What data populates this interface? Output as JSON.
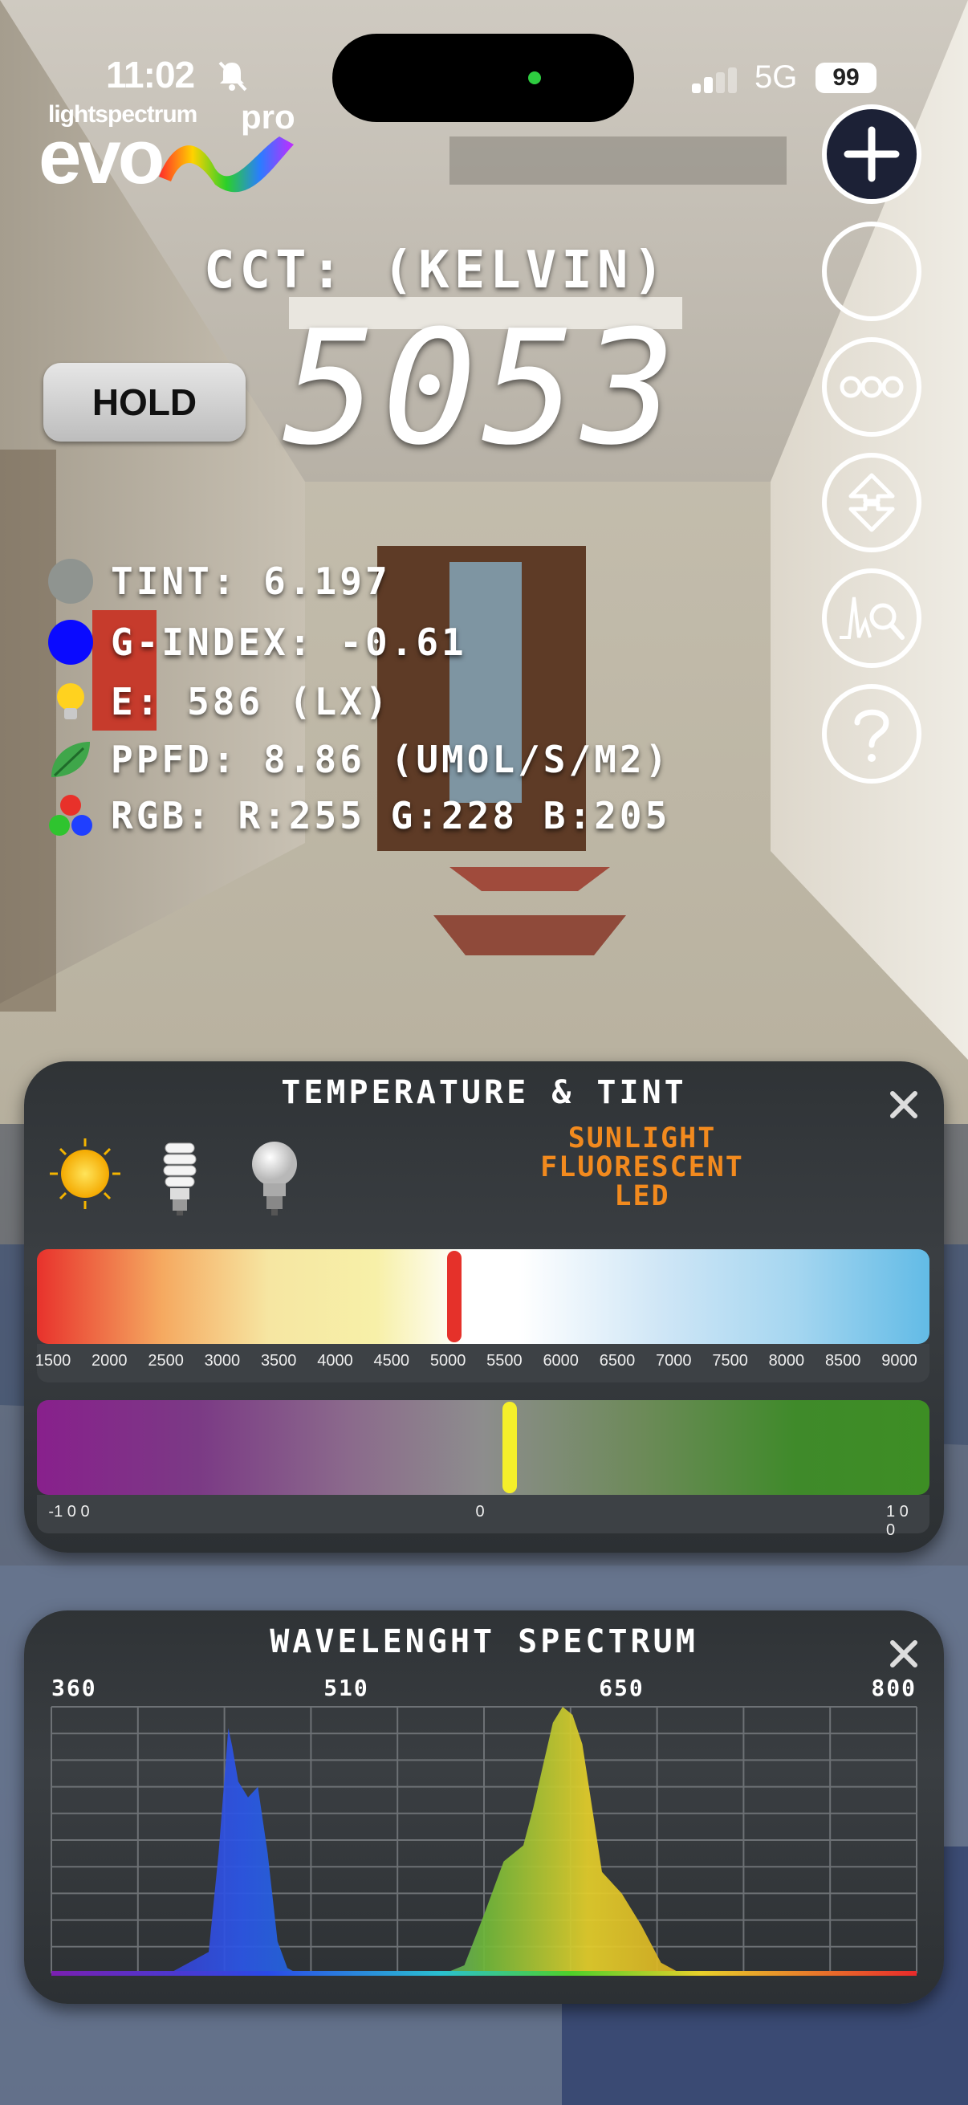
{
  "status_bar": {
    "time": "11:02",
    "network": "5G",
    "battery": "99"
  },
  "logo": {
    "top_text": "lightspectrum",
    "name": "evo",
    "suffix": "pro"
  },
  "cct": {
    "label": "CCT: (KELVIN)",
    "value": "5053"
  },
  "hold_label": "HOLD",
  "metrics": [
    {
      "icon": "gray-circle-icon",
      "text": "TINT: 6.197"
    },
    {
      "icon": "blue-circle-icon",
      "text": "G-INDEX: -0.61"
    },
    {
      "icon": "lightbulb-icon",
      "text": "E: 586 (LX)"
    },
    {
      "icon": "leaf-icon",
      "text": "PPFD: 8.86 (UMOL/S/M2)"
    },
    {
      "icon": "rgb-dots-icon",
      "text": "RGB: R:255 G:228 B:205"
    }
  ],
  "controls": [
    "plus-icon",
    "circle-icon",
    "more-icon",
    "rotate-icon",
    "spectrum-search-icon",
    "help-icon"
  ],
  "temp_panel": {
    "title": "TEMPERATURE & TINT",
    "source_icons": [
      "sun-icon",
      "cfl-bulb-icon",
      "led-bulb-icon"
    ],
    "light_types": [
      "SUNLIGHT",
      "FLUORESCENT",
      "LED"
    ],
    "kelvin_scale": [
      "1500",
      "2000",
      "2500",
      "3000",
      "3500",
      "4000",
      "4500",
      "5000",
      "5500",
      "6000",
      "6500",
      "7000",
      "7500",
      "8000",
      "8500",
      "9000"
    ],
    "kelvin_range": [
      1500,
      9000
    ],
    "kelvin_marker": 5053,
    "tint_scale": {
      "min": "-1 0 0",
      "mid": "0",
      "max": "1 0 0"
    },
    "tint_marker": 6.197,
    "colors": {
      "marker_cct": "#e5312a",
      "marker_tint": "#f5ef2a",
      "accent": "#f28a1e"
    }
  },
  "spectrum_panel": {
    "title": "WAVELENGHT SPECTRUM",
    "axis_labels": [
      "360",
      "510",
      "650",
      "800"
    ]
  },
  "chart_data": {
    "type": "area",
    "title": "WAVELENGHT SPECTRUM",
    "xlabel": "",
    "ylabel": "",
    "xlim": [
      360,
      800
    ],
    "ylim": [
      0,
      1
    ],
    "grid": true,
    "x": [
      360,
      420,
      440,
      445,
      450,
      452,
      455,
      460,
      465,
      470,
      475,
      480,
      485,
      490,
      500,
      520,
      540,
      560,
      570,
      580,
      590,
      600,
      605,
      610,
      615,
      620,
      625,
      630,
      635,
      640,
      650,
      660,
      670,
      680,
      700,
      800
    ],
    "y": [
      0,
      0,
      0.08,
      0.45,
      0.92,
      0.85,
      0.72,
      0.66,
      0.7,
      0.45,
      0.12,
      0.02,
      0,
      0,
      0,
      0,
      0,
      0,
      0.03,
      0.22,
      0.42,
      0.48,
      0.62,
      0.78,
      0.94,
      1.0,
      0.97,
      0.86,
      0.62,
      0.38,
      0.3,
      0.18,
      0.04,
      0,
      0,
      0
    ]
  }
}
